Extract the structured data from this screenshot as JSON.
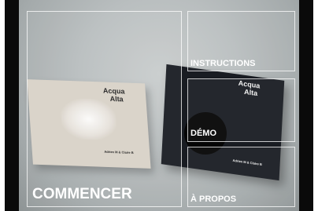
{
  "menu": {
    "start_label": "COMMENCER",
    "instructions_label": "INSTRUCTIONS",
    "demo_label": "DÉMO",
    "about_label": "À PROPOS"
  },
  "books": {
    "light": {
      "title_line1": "Acqua",
      "title_line2": "Alta",
      "publisher": "Adrien M & Claire B"
    },
    "dark": {
      "title_line1": "Acqua",
      "title_line2": "Alta",
      "publisher": "Adrien M & Claire B"
    }
  },
  "colors": {
    "menu_text": "#ffffff",
    "panel_border": "#ffffff",
    "backdrop": "#0a0a0a"
  }
}
